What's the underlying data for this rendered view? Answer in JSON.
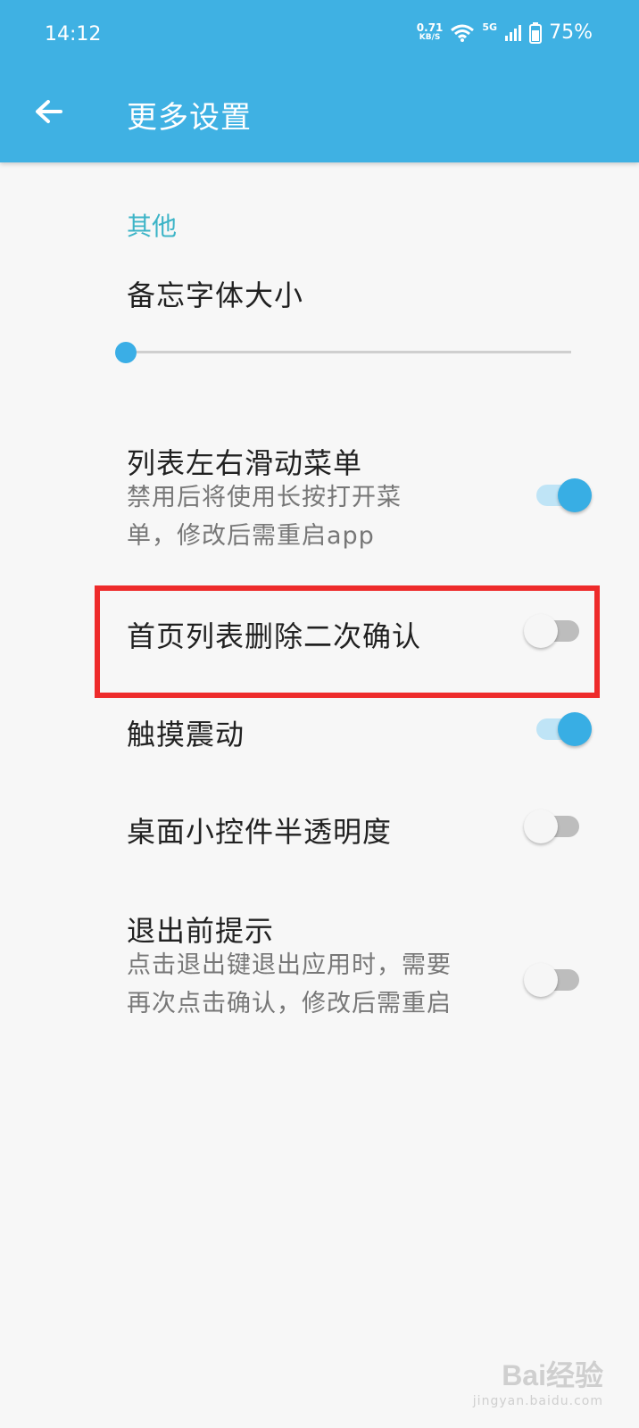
{
  "status_bar": {
    "time": "14:12",
    "net_speed_value": "0.71",
    "net_speed_unit": "KB/S",
    "network": "5G",
    "battery": "75%"
  },
  "header": {
    "title": "更多设置",
    "back_icon": "arrow-left-icon"
  },
  "section": {
    "title": "其他"
  },
  "settings": [
    {
      "title": "备忘字体大小",
      "type": "slider",
      "value": 0
    },
    {
      "title": "列表左右滑动菜单",
      "summary": "禁用后将使用长按打开菜单，修改后需重启app",
      "enabled": true
    },
    {
      "title": "首页列表删除二次确认",
      "enabled": false
    },
    {
      "title": "触摸震动",
      "enabled": true
    },
    {
      "title": "桌面小控件半透明度",
      "enabled": false
    },
    {
      "title": "退出前提示",
      "summary": "点击退出键退出应用时，需要再次点击确认，修改后需重启",
      "enabled": false
    }
  ],
  "colors": {
    "accent": "#3fb1e3",
    "section": "#3cb4c7",
    "highlight": "#ee2b2b"
  },
  "watermark": {
    "logo": "Bai",
    "logo_suffix": "经验",
    "url": "jingyan.baidu.com"
  }
}
